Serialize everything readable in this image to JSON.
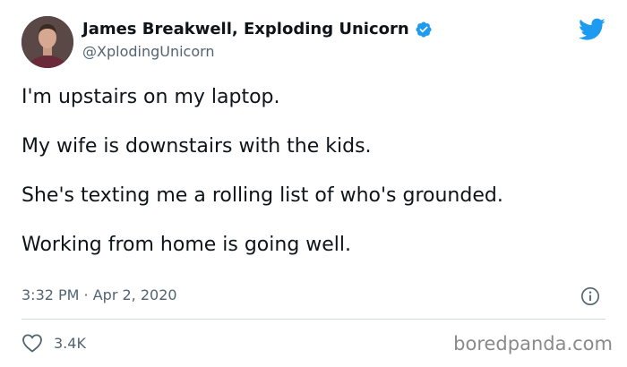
{
  "author": {
    "display_name": "James Breakwell, Exploding Unicorn",
    "handle": "@XplodingUnicorn",
    "verified": true,
    "avatar_icon": "profile-photo"
  },
  "tweet": {
    "lines": [
      "I'm upstairs on my laptop.",
      "My wife is downstairs with the kids.",
      "She's texting me a rolling list of who's grounded.",
      "Working from home is going well."
    ],
    "timestamp": "3:32 PM · Apr 2, 2020",
    "like_count": "3.4K"
  },
  "icons": {
    "brand": "twitter-bird-icon",
    "verified": "verified-badge-icon",
    "info": "info-icon",
    "like": "heart-icon"
  },
  "colors": {
    "brand_blue": "#1d9bf0",
    "secondary_text": "#536471",
    "divider": "#cfd9de"
  },
  "watermark": "boredpanda.com"
}
